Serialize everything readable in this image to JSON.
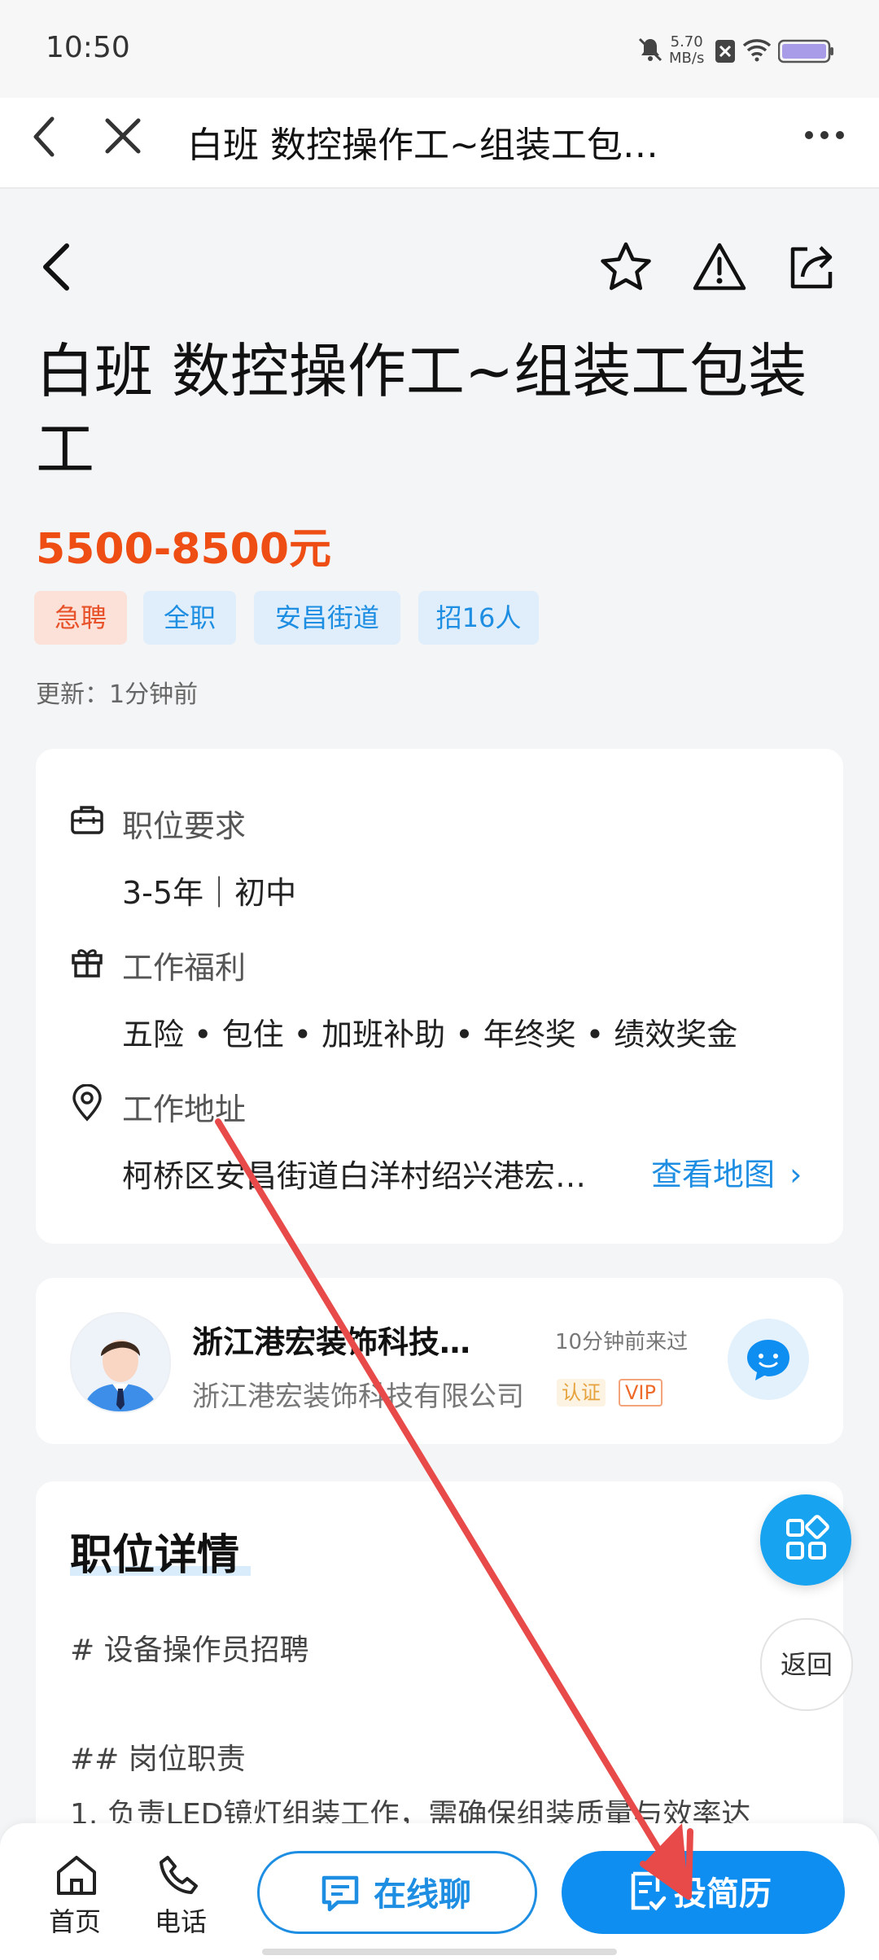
{
  "status_bar": {
    "time": "10:50",
    "net_speed_value": "5.70",
    "net_speed_unit": "MB/s",
    "icons": [
      "mute-icon",
      "sim-off-icon",
      "wifi-icon",
      "battery-icon"
    ]
  },
  "browser": {
    "title": "白班 数控操作工~组装工包…",
    "icons": [
      "back-icon",
      "close-icon",
      "more-icon"
    ]
  },
  "header": {
    "icons": [
      "back-icon",
      "star-icon",
      "warning-icon",
      "share-icon"
    ]
  },
  "job": {
    "title": "白班 数控操作工~组装工包装工",
    "salary": "5500-8500元",
    "tags": [
      "急聘",
      "全职",
      "安昌街道",
      "招16人"
    ],
    "updated": "更新：1分钟前"
  },
  "requirements": {
    "title": "职位要求",
    "value": "3-5年｜初中",
    "icon": "briefcase-icon"
  },
  "benefits": {
    "title": "工作福利",
    "value": "五险 • 包住 • 加班补助 • 年终奖 • 绩效奖金",
    "icon": "gift-icon"
  },
  "address": {
    "title": "工作地址",
    "value": "柯桥区安昌街道白洋村绍兴港宏…",
    "map_link": "查看地图",
    "icon": "location-icon"
  },
  "company": {
    "short_name": "浙江港宏装饰科技…",
    "visit": "10分钟前来过",
    "full_name": "浙江港宏装饰科技有限公司",
    "badge_verified": "认证",
    "badge_vip": "VIP"
  },
  "details": {
    "title": "职位详情",
    "lines": [
      "# 设备操作员招聘",
      "## 岗位职责",
      "1. 负责LED镜灯组装工作，需确保组装质量与效率达"
    ]
  },
  "floating": {
    "back_label": "返回"
  },
  "bottom_bar": {
    "home_label": "首页",
    "phone_label": "电话",
    "chat_label": "在线聊",
    "apply_label": "投简历"
  },
  "colors": {
    "accent": "#0e8ef0",
    "salary": "#ee4d14",
    "annotation": "#e84a4a"
  }
}
